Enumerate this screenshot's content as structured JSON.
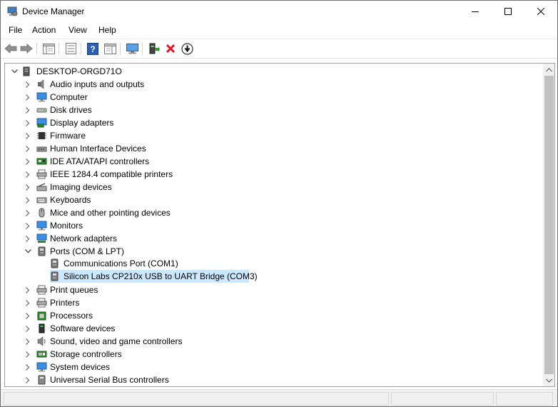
{
  "window": {
    "title": "Device Manager"
  },
  "menu": [
    "File",
    "Action",
    "View",
    "Help"
  ],
  "toolbar": {
    "buttons": [
      "back-arrow-icon",
      "forward-arrow-icon",
      "show-hide-console-tree-icon",
      "properties-icon",
      "help-icon",
      "action-pane-icon",
      "scan-hardware-icon",
      "update-driver-icon",
      "uninstall-device-icon",
      "disable-device-icon"
    ]
  },
  "tree": {
    "root": "DESKTOP-ORGD71O",
    "categories": [
      "Audio inputs and outputs",
      "Computer",
      "Disk drives",
      "Display adapters",
      "Firmware",
      "Human Interface Devices",
      "IDE ATA/ATAPI controllers",
      "IEEE 1284.4 compatible printers",
      "Imaging devices",
      "Keyboards",
      "Mice and other pointing devices",
      "Monitors",
      "Network adapters",
      "Ports (COM & LPT)",
      "Print queues",
      "Printers",
      "Processors",
      "Software devices",
      "Sound, video and game controllers",
      "Storage controllers",
      "System devices",
      "Universal Serial Bus controllers"
    ],
    "ports_children": [
      "Communications Port (COM1)",
      "Silicon Labs CP210x USB to UART Bridge (COM3)"
    ],
    "selected": "Silicon Labs CP210x USB to UART Bridge (COM3)"
  },
  "colors": {
    "selection": "#cce8ff",
    "uninstall_red": "#e81123",
    "help_blue": "#2b5fb4"
  }
}
